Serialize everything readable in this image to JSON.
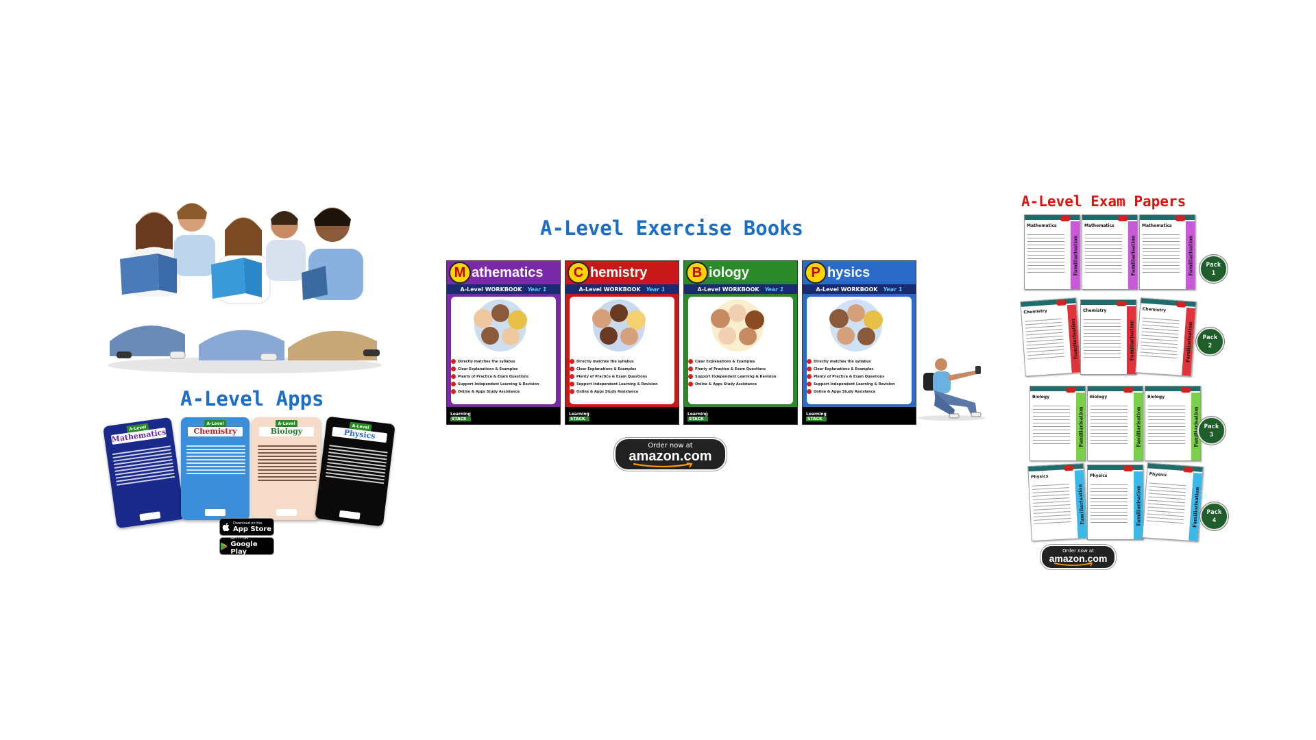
{
  "apps": {
    "title": "A-Level Apps",
    "cards": [
      {
        "badge": "A-Level",
        "subject": "Mathematics",
        "bg": "#1a2a8a",
        "title_color": "#6a2aa8"
      },
      {
        "badge": "A-Level",
        "subject": "Chemistry",
        "bg": "#3d8ed8",
        "title_color": "#c01818"
      },
      {
        "badge": "A-Level",
        "subject": "Biology",
        "bg": "#f6dcc8",
        "title_color": "#2a7a2a"
      },
      {
        "badge": "A-Level",
        "subject": "Physics",
        "bg": "#0a0a0a",
        "title_color": "#2a6ac8"
      }
    ],
    "app_store": {
      "small": "Download on the",
      "big": "App Store"
    },
    "google_play": {
      "small": "GET IT ON",
      "big": "Google Play"
    }
  },
  "books": {
    "title": "A-Level Exercise Books",
    "items": [
      {
        "letter": "M",
        "rest": "athematics",
        "color": "#7a2aa8",
        "workbook": "A-Level WORKBOOK",
        "year": "Year 1"
      },
      {
        "letter": "C",
        "rest": "hemistry",
        "color": "#c81818",
        "workbook": "A-Level WORKBOOK",
        "year": "Year 1"
      },
      {
        "letter": "B",
        "rest": "iology",
        "color": "#2a8a2a",
        "workbook": "A-Level WORKBOOK",
        "year": "Year 1"
      },
      {
        "letter": "P",
        "rest": "hysics",
        "color": "#2a6ac8",
        "workbook": "A-Level WORKBOOK",
        "year": "Year 1"
      }
    ],
    "features": [
      "Directly matches the syllabus",
      "Clear Explanations & Examples",
      "Plenty of Practice & Exam Questions",
      "Support Independent Learning & Revision",
      "Online & Apps Study Assistance"
    ],
    "features_short": [
      "Clear Explanations & Examples",
      "Plenty of Practice & Exam Questions",
      "Support Independent Learning & Revision",
      "Online & Apps Study Assistance"
    ],
    "brand_top": "Learning",
    "brand_bottom": "STACK",
    "amazon": {
      "small": "Order now at",
      "big": "amazon.com"
    }
  },
  "exam": {
    "title": "A-Level Exam Papers",
    "side_label": "Familiarisation",
    "packs": [
      {
        "label": "Pack",
        "number": "1",
        "subject": "Mathematics",
        "color": "#c85ad8"
      },
      {
        "label": "Pack",
        "number": "2",
        "subject": "Chemistry",
        "color": "#e0343c"
      },
      {
        "label": "Pack",
        "number": "3",
        "subject": "Biology",
        "color": "#7ad04a"
      },
      {
        "label": "Pack",
        "number": "4",
        "subject": "Physics",
        "color": "#3ab8e8"
      }
    ],
    "amazon": {
      "small": "Order now at",
      "big": "amazon.com"
    }
  },
  "colors": {
    "heading_blue": "#1a6ec8",
    "heading_red": "#e01010"
  }
}
